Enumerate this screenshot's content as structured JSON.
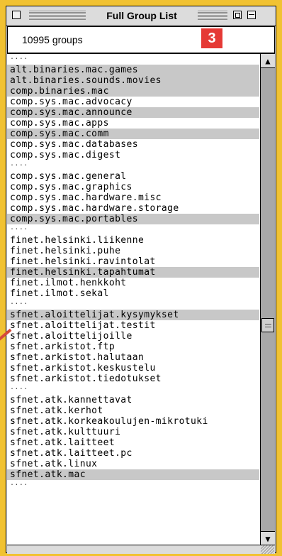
{
  "window": {
    "title": "Full Group List",
    "group_count": "10995 groups",
    "badge": "3"
  },
  "groups": [
    {
      "text": "....",
      "sep": true
    },
    {
      "text": "alt.binaries.mac.games",
      "sel": true
    },
    {
      "text": "alt.binaries.sounds.movies",
      "sel": true
    },
    {
      "text": "comp.binaries.mac",
      "sel": true
    },
    {
      "text": "comp.sys.mac.advocacy"
    },
    {
      "text": "comp.sys.mac.announce",
      "sel": true
    },
    {
      "text": "comp.sys.mac.apps"
    },
    {
      "text": "comp.sys.mac.comm",
      "sel": true
    },
    {
      "text": "comp.sys.mac.databases"
    },
    {
      "text": "comp.sys.mac.digest"
    },
    {
      "text": "....",
      "sep": true
    },
    {
      "text": "comp.sys.mac.general"
    },
    {
      "text": "comp.sys.mac.graphics"
    },
    {
      "text": "comp.sys.mac.hardware.misc"
    },
    {
      "text": "comp.sys.mac.hardware.storage"
    },
    {
      "text": "comp.sys.mac.portables",
      "sel": true
    },
    {
      "text": "....",
      "sep": true
    },
    {
      "text": "finet.helsinki.liikenne"
    },
    {
      "text": "finet.helsinki.puhe"
    },
    {
      "text": "finet.helsinki.ravintolat"
    },
    {
      "text": "finet.helsinki.tapahtumat",
      "sel": true
    },
    {
      "text": "finet.ilmot.henkkoht"
    },
    {
      "text": "finet.ilmot.sekal"
    },
    {
      "text": "....",
      "sep": true
    },
    {
      "text": "sfnet.aloittelijat.kysymykset",
      "sel": true
    },
    {
      "text": "sfnet.aloittelijat.testit"
    },
    {
      "text": "sfnet.aloittelijoille"
    },
    {
      "text": "sfnet.arkistot.ftp"
    },
    {
      "text": "sfnet.arkistot.halutaan"
    },
    {
      "text": "sfnet.arkistot.keskustelu"
    },
    {
      "text": "sfnet.arkistot.tiedotukset"
    },
    {
      "text": "....",
      "sep": true
    },
    {
      "text": "sfnet.atk.kannettavat"
    },
    {
      "text": "sfnet.atk.kerhot"
    },
    {
      "text": "sfnet.atk.korkeakoulujen-mikrotuki"
    },
    {
      "text": "sfnet.atk.kulttuuri"
    },
    {
      "text": "sfnet.atk.laitteet"
    },
    {
      "text": "sfnet.atk.laitteet.pc"
    },
    {
      "text": "sfnet.atk.linux"
    },
    {
      "text": "sfnet.atk.mac",
      "sel": true
    },
    {
      "text": "....",
      "sep": true
    }
  ],
  "icons": {
    "scroll_up": "▲",
    "scroll_down": "▼"
  }
}
